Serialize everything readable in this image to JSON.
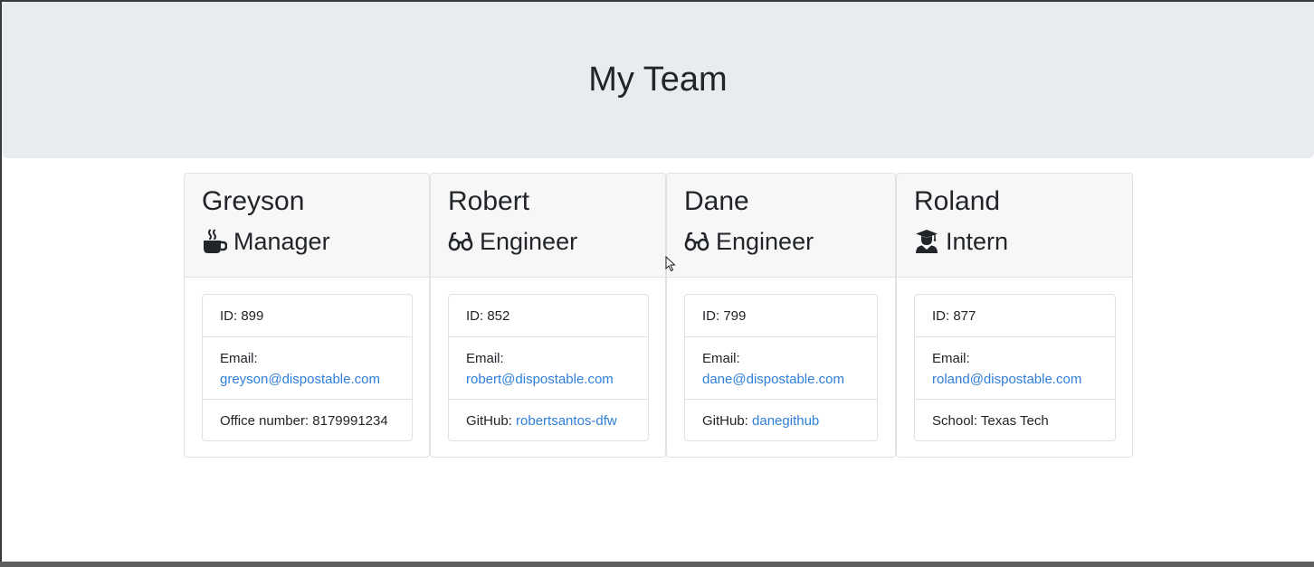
{
  "header": {
    "title": "My Team"
  },
  "team": [
    {
      "name": "Greyson",
      "role": "Manager",
      "icon": "coffee-icon",
      "id_text": "ID: 899",
      "email_label": "Email:",
      "email": "greyson@dispostable.com",
      "extra_label": "Office number: 8179991234",
      "extra_link": ""
    },
    {
      "name": "Robert",
      "role": "Engineer",
      "icon": "glasses-icon",
      "id_text": "ID: 852",
      "email_label": "Email:",
      "email": "robert@dispostable.com",
      "extra_label": "GitHub: ",
      "extra_link": "robertsantos-dfw"
    },
    {
      "name": "Dane",
      "role": "Engineer",
      "icon": "glasses-icon",
      "id_text": "ID: 799",
      "email_label": "Email:",
      "email": "dane@dispostable.com",
      "extra_label": "GitHub: ",
      "extra_link": "danegithub"
    },
    {
      "name": "Roland",
      "role": "Intern",
      "icon": "graduate-icon",
      "id_text": "ID: 877",
      "email_label": "Email:",
      "email": "roland@dispostable.com",
      "extra_label": "School: Texas Tech",
      "extra_link": ""
    }
  ],
  "colors": {
    "jumbotron_bg": "#e9ecef",
    "link": "#2f7ed8",
    "card_header_bg": "#f7f7f8",
    "text": "#212529"
  }
}
